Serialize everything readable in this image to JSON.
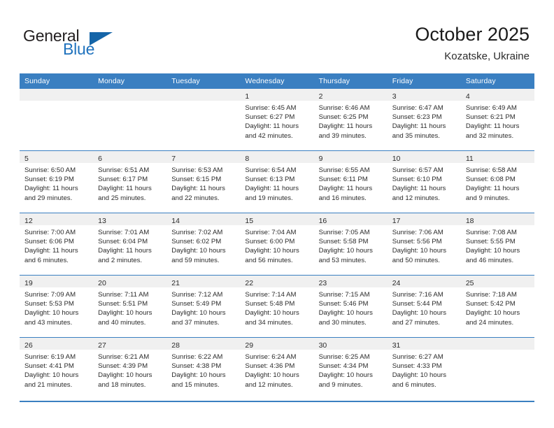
{
  "brand": {
    "word_one": "General",
    "word_two": "Blue",
    "triangle_icon": "triangle-icon",
    "colors": {
      "blue": "#1f72bd",
      "triangle": "#1565a8",
      "dark": "#231f20"
    }
  },
  "header": {
    "title": "October 2025",
    "subtitle": "Kozatske, Ukraine"
  },
  "theme": {
    "header_blue": "#3a7fc1",
    "daynum_band": "#f0f0f0",
    "text": "#2b2b2b"
  },
  "weekday_headers": [
    "Sunday",
    "Monday",
    "Tuesday",
    "Wednesday",
    "Thursday",
    "Friday",
    "Saturday"
  ],
  "weeks": [
    [
      {
        "day": "",
        "lines": []
      },
      {
        "day": "",
        "lines": []
      },
      {
        "day": "",
        "lines": []
      },
      {
        "day": "1",
        "lines": [
          "Sunrise: 6:45 AM",
          "Sunset: 6:27 PM",
          "Daylight: 11 hours",
          "and 42 minutes."
        ]
      },
      {
        "day": "2",
        "lines": [
          "Sunrise: 6:46 AM",
          "Sunset: 6:25 PM",
          "Daylight: 11 hours",
          "and 39 minutes."
        ]
      },
      {
        "day": "3",
        "lines": [
          "Sunrise: 6:47 AM",
          "Sunset: 6:23 PM",
          "Daylight: 11 hours",
          "and 35 minutes."
        ]
      },
      {
        "day": "4",
        "lines": [
          "Sunrise: 6:49 AM",
          "Sunset: 6:21 PM",
          "Daylight: 11 hours",
          "and 32 minutes."
        ]
      }
    ],
    [
      {
        "day": "5",
        "lines": [
          "Sunrise: 6:50 AM",
          "Sunset: 6:19 PM",
          "Daylight: 11 hours",
          "and 29 minutes."
        ]
      },
      {
        "day": "6",
        "lines": [
          "Sunrise: 6:51 AM",
          "Sunset: 6:17 PM",
          "Daylight: 11 hours",
          "and 25 minutes."
        ]
      },
      {
        "day": "7",
        "lines": [
          "Sunrise: 6:53 AM",
          "Sunset: 6:15 PM",
          "Daylight: 11 hours",
          "and 22 minutes."
        ]
      },
      {
        "day": "8",
        "lines": [
          "Sunrise: 6:54 AM",
          "Sunset: 6:13 PM",
          "Daylight: 11 hours",
          "and 19 minutes."
        ]
      },
      {
        "day": "9",
        "lines": [
          "Sunrise: 6:55 AM",
          "Sunset: 6:11 PM",
          "Daylight: 11 hours",
          "and 16 minutes."
        ]
      },
      {
        "day": "10",
        "lines": [
          "Sunrise: 6:57 AM",
          "Sunset: 6:10 PM",
          "Daylight: 11 hours",
          "and 12 minutes."
        ]
      },
      {
        "day": "11",
        "lines": [
          "Sunrise: 6:58 AM",
          "Sunset: 6:08 PM",
          "Daylight: 11 hours",
          "and 9 minutes."
        ]
      }
    ],
    [
      {
        "day": "12",
        "lines": [
          "Sunrise: 7:00 AM",
          "Sunset: 6:06 PM",
          "Daylight: 11 hours",
          "and 6 minutes."
        ]
      },
      {
        "day": "13",
        "lines": [
          "Sunrise: 7:01 AM",
          "Sunset: 6:04 PM",
          "Daylight: 11 hours",
          "and 2 minutes."
        ]
      },
      {
        "day": "14",
        "lines": [
          "Sunrise: 7:02 AM",
          "Sunset: 6:02 PM",
          "Daylight: 10 hours",
          "and 59 minutes."
        ]
      },
      {
        "day": "15",
        "lines": [
          "Sunrise: 7:04 AM",
          "Sunset: 6:00 PM",
          "Daylight: 10 hours",
          "and 56 minutes."
        ]
      },
      {
        "day": "16",
        "lines": [
          "Sunrise: 7:05 AM",
          "Sunset: 5:58 PM",
          "Daylight: 10 hours",
          "and 53 minutes."
        ]
      },
      {
        "day": "17",
        "lines": [
          "Sunrise: 7:06 AM",
          "Sunset: 5:56 PM",
          "Daylight: 10 hours",
          "and 50 minutes."
        ]
      },
      {
        "day": "18",
        "lines": [
          "Sunrise: 7:08 AM",
          "Sunset: 5:55 PM",
          "Daylight: 10 hours",
          "and 46 minutes."
        ]
      }
    ],
    [
      {
        "day": "19",
        "lines": [
          "Sunrise: 7:09 AM",
          "Sunset: 5:53 PM",
          "Daylight: 10 hours",
          "and 43 minutes."
        ]
      },
      {
        "day": "20",
        "lines": [
          "Sunrise: 7:11 AM",
          "Sunset: 5:51 PM",
          "Daylight: 10 hours",
          "and 40 minutes."
        ]
      },
      {
        "day": "21",
        "lines": [
          "Sunrise: 7:12 AM",
          "Sunset: 5:49 PM",
          "Daylight: 10 hours",
          "and 37 minutes."
        ]
      },
      {
        "day": "22",
        "lines": [
          "Sunrise: 7:14 AM",
          "Sunset: 5:48 PM",
          "Daylight: 10 hours",
          "and 34 minutes."
        ]
      },
      {
        "day": "23",
        "lines": [
          "Sunrise: 7:15 AM",
          "Sunset: 5:46 PM",
          "Daylight: 10 hours",
          "and 30 minutes."
        ]
      },
      {
        "day": "24",
        "lines": [
          "Sunrise: 7:16 AM",
          "Sunset: 5:44 PM",
          "Daylight: 10 hours",
          "and 27 minutes."
        ]
      },
      {
        "day": "25",
        "lines": [
          "Sunrise: 7:18 AM",
          "Sunset: 5:42 PM",
          "Daylight: 10 hours",
          "and 24 minutes."
        ]
      }
    ],
    [
      {
        "day": "26",
        "lines": [
          "Sunrise: 6:19 AM",
          "Sunset: 4:41 PM",
          "Daylight: 10 hours",
          "and 21 minutes."
        ]
      },
      {
        "day": "27",
        "lines": [
          "Sunrise: 6:21 AM",
          "Sunset: 4:39 PM",
          "Daylight: 10 hours",
          "and 18 minutes."
        ]
      },
      {
        "day": "28",
        "lines": [
          "Sunrise: 6:22 AM",
          "Sunset: 4:38 PM",
          "Daylight: 10 hours",
          "and 15 minutes."
        ]
      },
      {
        "day": "29",
        "lines": [
          "Sunrise: 6:24 AM",
          "Sunset: 4:36 PM",
          "Daylight: 10 hours",
          "and 12 minutes."
        ]
      },
      {
        "day": "30",
        "lines": [
          "Sunrise: 6:25 AM",
          "Sunset: 4:34 PM",
          "Daylight: 10 hours",
          "and 9 minutes."
        ]
      },
      {
        "day": "31",
        "lines": [
          "Sunrise: 6:27 AM",
          "Sunset: 4:33 PM",
          "Daylight: 10 hours",
          "and 6 minutes."
        ]
      },
      {
        "day": "",
        "lines": []
      }
    ]
  ]
}
